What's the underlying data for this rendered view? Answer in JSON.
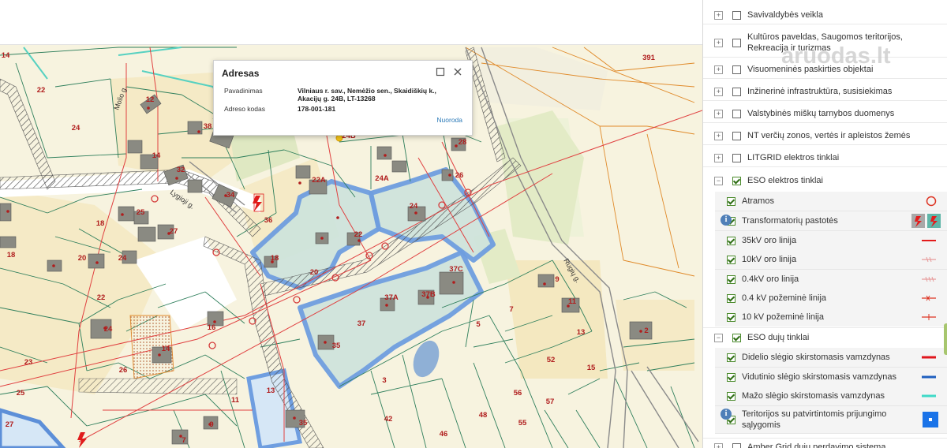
{
  "popup": {
    "title": "Adresas",
    "label_name": "Pavadinimas",
    "value_name_line1": "Vilniaus r. sav., Nemėžio sen., Skaidiškių k.,",
    "value_name_line2": "Akacijų g. 24B, LT-13268",
    "label_code": "Adreso kodas",
    "value_code": "178-001-181",
    "link": "Nuoroda"
  },
  "map": {
    "streets": [
      "Molio g.",
      "Lygioji g.",
      "Rugių g."
    ],
    "parcel_labels": [
      "14",
      "22",
      "24",
      "12",
      "38",
      "14",
      "32",
      "34",
      "22A",
      "24A",
      "24B",
      "28",
      "26",
      "36",
      "25",
      "18",
      "27",
      "24",
      "20",
      "18",
      "22",
      "16",
      "24",
      "14",
      "26",
      "13",
      "23",
      "25",
      "27",
      "11",
      "9",
      "35",
      "37",
      "7",
      "37A",
      "37B",
      "37C",
      "22",
      "20",
      "18",
      "36",
      "3",
      "42",
      "46",
      "48",
      "55",
      "56",
      "57",
      "52",
      "15",
      "13",
      "5",
      "7",
      "9",
      "11",
      "2",
      "391"
    ]
  },
  "panel": {
    "items": [
      {
        "label": "Savivaldybės veikla",
        "checked": false,
        "expander": "+"
      },
      {
        "label": "Kultūros paveldas, Saugomos teritorijos,",
        "label2": "Rekreacija ir turizmas",
        "checked": false,
        "expander": "+"
      },
      {
        "label": "Visuomeninės paskirties objektai",
        "checked": false,
        "expander": "+"
      },
      {
        "label": "Inžinerinė infrastruktūra, susisiekimas",
        "checked": false,
        "expander": "+"
      },
      {
        "label": "Valstybinės miškų tarnybos duomenys",
        "checked": false,
        "expander": "+"
      },
      {
        "label": "NT verčių zonos, vertės ir apleistos žemės",
        "checked": false,
        "expander": "+"
      },
      {
        "label": "LITGRID elektros tinklai",
        "checked": false,
        "expander": "+"
      },
      {
        "label": "ESO elektros tinklai",
        "checked": true,
        "expander": "−"
      },
      {
        "label": "ESO dujų tinklai",
        "checked": true,
        "expander": "−"
      },
      {
        "label": "Amber Grid dujų perdavimo sistema",
        "checked": false,
        "expander": "+"
      }
    ],
    "eso_elec": [
      {
        "label": "Atramos",
        "symbol": "circle-red"
      },
      {
        "label": "Transformatorių pastotės",
        "symbol": "substation-icons",
        "info": true
      },
      {
        "label": "35kV oro linija",
        "symbol": "line-red"
      },
      {
        "label": "10kV oro linija",
        "symbol": "line-pink-tick"
      },
      {
        "label": "0.4kV oro linija",
        "symbol": "line-pink-tick2"
      },
      {
        "label": "0.4 kV požeminė linija",
        "symbol": "line-red-x"
      },
      {
        "label": "10 kV požeminė linija",
        "symbol": "line-red-tick"
      }
    ],
    "eso_gas": [
      {
        "label": "Didelio slėgio skirstomasis vamzdynas",
        "color": "#e0161d"
      },
      {
        "label": "Vidutinio slėgio skirstomasis vamzdynas",
        "color": "#1f5fbf"
      },
      {
        "label": "Mažo slėgio skirstomasis vamzdynas",
        "color": "#3ed9c7"
      },
      {
        "label": "Teritorijos su patvirtintomis prijungimo",
        "label2": "sąlygomis",
        "color": "#1a73e8",
        "info": true
      }
    ]
  },
  "watermark": "aruodas.lt"
}
